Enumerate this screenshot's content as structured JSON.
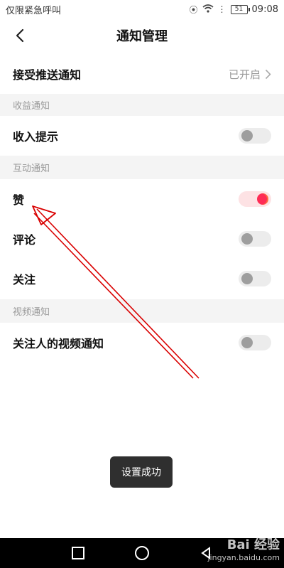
{
  "status_bar": {
    "left_text": "仅限紧急呼叫",
    "battery": "51",
    "time": "09:08"
  },
  "header": {
    "title": "通知管理"
  },
  "push": {
    "label": "接受推送通知",
    "status": "已开启"
  },
  "sections": {
    "income": "收益通知",
    "interaction": "互动通知",
    "video": "视频通知"
  },
  "items": {
    "income_tip": {
      "label": "收入提示",
      "on": false
    },
    "like": {
      "label": "赞",
      "on": true
    },
    "comment": {
      "label": "评论",
      "on": false
    },
    "follow": {
      "label": "关注",
      "on": false
    },
    "follow_video": {
      "label": "关注人的视频通知",
      "on": false
    }
  },
  "toast": {
    "text": "设置成功"
  },
  "watermark": {
    "line1": "Bai 经验",
    "line2": "jingyan.baidu.com"
  },
  "colors": {
    "accent": "#fe2c55",
    "section_bg": "#f4f4f4",
    "annotation_arrow": "#d90000"
  }
}
